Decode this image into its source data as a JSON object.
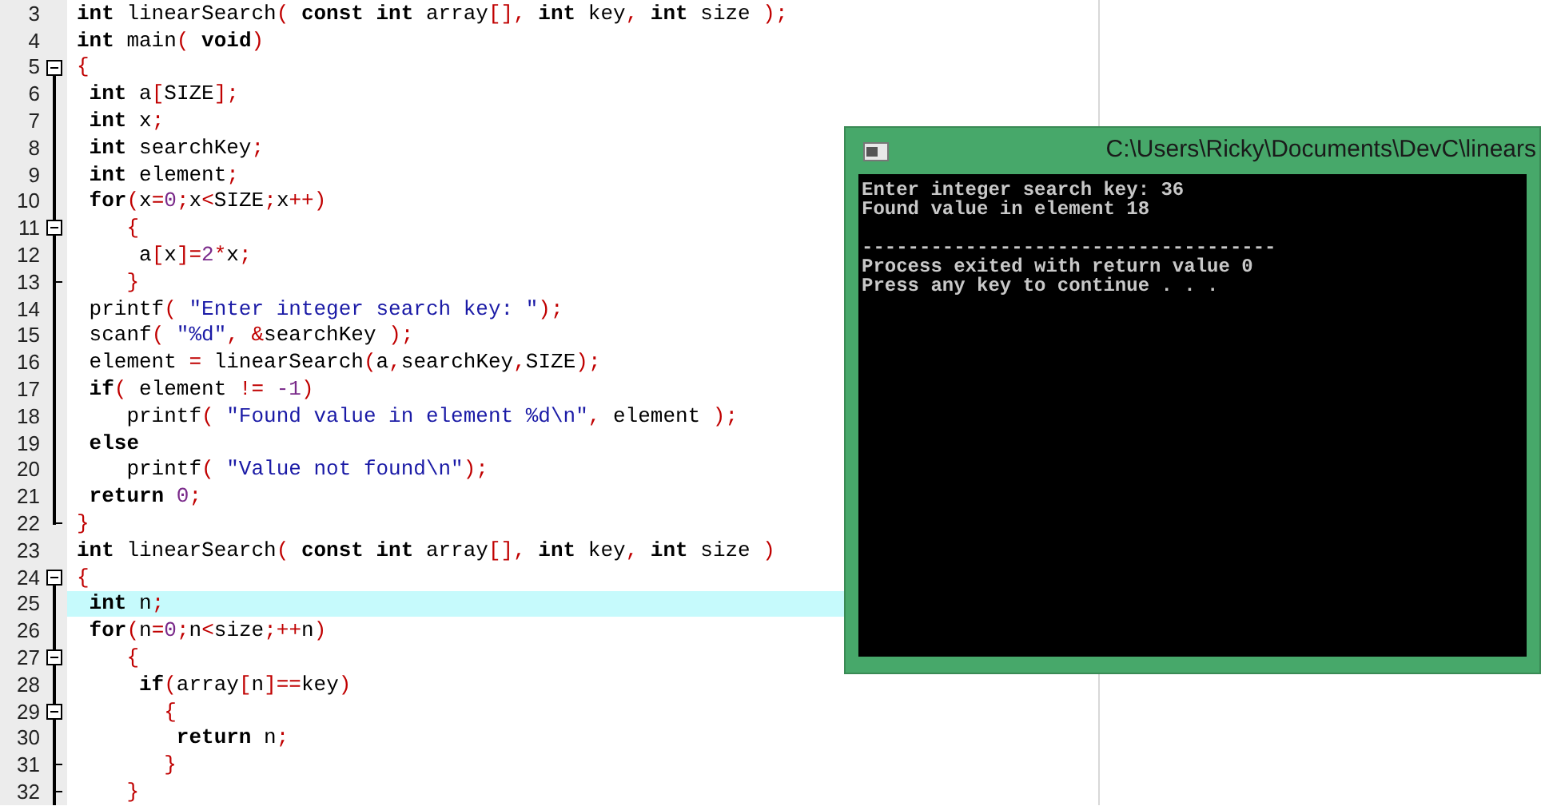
{
  "editor": {
    "lines": [
      {
        "number": "3",
        "kind": "none",
        "selected": false,
        "tokens": [
          {
            "kind": "kw",
            "text": "int"
          },
          {
            "kind": "id",
            "text": " linearSearch"
          },
          {
            "kind": "sym",
            "text": "("
          },
          {
            "kind": "kw",
            "text": " const int"
          },
          {
            "kind": "id",
            "text": " array"
          },
          {
            "kind": "sym",
            "text": "[],"
          },
          {
            "kind": "kw",
            "text": " int"
          },
          {
            "kind": "id",
            "text": " key"
          },
          {
            "kind": "sym",
            "text": ","
          },
          {
            "kind": "kw",
            "text": " int"
          },
          {
            "kind": "id",
            "text": " size "
          },
          {
            "kind": "sym",
            "text": ");"
          }
        ]
      },
      {
        "number": "4",
        "kind": "none",
        "selected": false,
        "tokens": [
          {
            "kind": "kw",
            "text": "int"
          },
          {
            "kind": "id",
            "text": " main"
          },
          {
            "kind": "sym",
            "text": "("
          },
          {
            "kind": "kw",
            "text": " void"
          },
          {
            "kind": "sym",
            "text": ")"
          }
        ]
      },
      {
        "number": "5",
        "kind": "open",
        "selected": false,
        "tokens": [
          {
            "kind": "sym",
            "text": "{"
          }
        ]
      },
      {
        "number": "6",
        "kind": "line",
        "selected": false,
        "tokens": [
          {
            "kind": "kw",
            "text": " int"
          },
          {
            "kind": "id",
            "text": " a"
          },
          {
            "kind": "sym",
            "text": "["
          },
          {
            "kind": "id",
            "text": "SIZE"
          },
          {
            "kind": "sym",
            "text": "];"
          }
        ]
      },
      {
        "number": "7",
        "kind": "line",
        "selected": false,
        "tokens": [
          {
            "kind": "kw",
            "text": " int"
          },
          {
            "kind": "id",
            "text": " x"
          },
          {
            "kind": "sym",
            "text": ";"
          }
        ]
      },
      {
        "number": "8",
        "kind": "line",
        "selected": false,
        "tokens": [
          {
            "kind": "kw",
            "text": " int"
          },
          {
            "kind": "id",
            "text": " searchKey"
          },
          {
            "kind": "sym",
            "text": ";"
          }
        ]
      },
      {
        "number": "9",
        "kind": "line",
        "selected": false,
        "tokens": [
          {
            "kind": "kw",
            "text": " int"
          },
          {
            "kind": "id",
            "text": " element"
          },
          {
            "kind": "sym",
            "text": ";"
          }
        ]
      },
      {
        "number": "10",
        "kind": "line",
        "selected": false,
        "tokens": [
          {
            "kind": "kw",
            "text": " for"
          },
          {
            "kind": "sym",
            "text": "("
          },
          {
            "kind": "id",
            "text": "x"
          },
          {
            "kind": "sym",
            "text": "="
          },
          {
            "kind": "num",
            "text": "0"
          },
          {
            "kind": "sym",
            "text": ";"
          },
          {
            "kind": "id",
            "text": "x"
          },
          {
            "kind": "sym",
            "text": "<"
          },
          {
            "kind": "id",
            "text": "SIZE"
          },
          {
            "kind": "sym",
            "text": ";"
          },
          {
            "kind": "id",
            "text": "x"
          },
          {
            "kind": "sym",
            "text": "++)"
          }
        ]
      },
      {
        "number": "11",
        "kind": "open_inner",
        "selected": false,
        "tokens": [
          {
            "kind": "sym",
            "text": "    {"
          }
        ]
      },
      {
        "number": "12",
        "kind": "line",
        "selected": false,
        "tokens": [
          {
            "kind": "id",
            "text": "     a"
          },
          {
            "kind": "sym",
            "text": "["
          },
          {
            "kind": "id",
            "text": "x"
          },
          {
            "kind": "sym",
            "text": "]="
          },
          {
            "kind": "num",
            "text": "2"
          },
          {
            "kind": "sym",
            "text": "*"
          },
          {
            "kind": "id",
            "text": "x"
          },
          {
            "kind": "sym",
            "text": ";"
          }
        ]
      },
      {
        "number": "13",
        "kind": "end_inner",
        "selected": false,
        "tokens": [
          {
            "kind": "sym",
            "text": "    }"
          }
        ]
      },
      {
        "number": "14",
        "kind": "line",
        "selected": false,
        "tokens": [
          {
            "kind": "id",
            "text": " printf"
          },
          {
            "kind": "sym",
            "text": "("
          },
          {
            "kind": "str",
            "text": " \"Enter integer search key: \""
          },
          {
            "kind": "sym",
            "text": ");"
          }
        ]
      },
      {
        "number": "15",
        "kind": "line",
        "selected": false,
        "tokens": [
          {
            "kind": "id",
            "text": " scanf"
          },
          {
            "kind": "sym",
            "text": "("
          },
          {
            "kind": "str",
            "text": " \"%d\""
          },
          {
            "kind": "sym",
            "text": ", &"
          },
          {
            "kind": "id",
            "text": "searchKey "
          },
          {
            "kind": "sym",
            "text": ");"
          }
        ]
      },
      {
        "number": "16",
        "kind": "line",
        "selected": false,
        "tokens": [
          {
            "kind": "id",
            "text": " element "
          },
          {
            "kind": "sym",
            "text": "="
          },
          {
            "kind": "id",
            "text": " linearSearch"
          },
          {
            "kind": "sym",
            "text": "("
          },
          {
            "kind": "id",
            "text": "a"
          },
          {
            "kind": "sym",
            "text": ","
          },
          {
            "kind": "id",
            "text": "searchKey"
          },
          {
            "kind": "sym",
            "text": ","
          },
          {
            "kind": "id",
            "text": "SIZE"
          },
          {
            "kind": "sym",
            "text": ");"
          }
        ]
      },
      {
        "number": "17",
        "kind": "line",
        "selected": false,
        "tokens": [
          {
            "kind": "kw",
            "text": " if"
          },
          {
            "kind": "sym",
            "text": "("
          },
          {
            "kind": "id",
            "text": " element "
          },
          {
            "kind": "sym",
            "text": "!= "
          },
          {
            "kind": "num",
            "text": "-1"
          },
          {
            "kind": "sym",
            "text": ")"
          }
        ]
      },
      {
        "number": "18",
        "kind": "line",
        "selected": false,
        "tokens": [
          {
            "kind": "id",
            "text": "    printf"
          },
          {
            "kind": "sym",
            "text": "("
          },
          {
            "kind": "str",
            "text": " \"Found value in element %d\\n\""
          },
          {
            "kind": "sym",
            "text": ","
          },
          {
            "kind": "id",
            "text": " element "
          },
          {
            "kind": "sym",
            "text": ");"
          }
        ]
      },
      {
        "number": "19",
        "kind": "line",
        "selected": false,
        "tokens": [
          {
            "kind": "kw",
            "text": " else"
          }
        ]
      },
      {
        "number": "20",
        "kind": "line",
        "selected": false,
        "tokens": [
          {
            "kind": "id",
            "text": "    printf"
          },
          {
            "kind": "sym",
            "text": "("
          },
          {
            "kind": "str",
            "text": " \"Value not found\\n\""
          },
          {
            "kind": "sym",
            "text": ");"
          }
        ]
      },
      {
        "number": "21",
        "kind": "line",
        "selected": false,
        "tokens": [
          {
            "kind": "kw",
            "text": " return"
          },
          {
            "kind": "num",
            "text": " 0"
          },
          {
            "kind": "sym",
            "text": ";"
          }
        ]
      },
      {
        "number": "22",
        "kind": "end",
        "selected": false,
        "tokens": [
          {
            "kind": "sym",
            "text": "}"
          }
        ]
      },
      {
        "number": "23",
        "kind": "none",
        "selected": false,
        "tokens": [
          {
            "kind": "kw",
            "text": "int"
          },
          {
            "kind": "id",
            "text": " linearSearch"
          },
          {
            "kind": "sym",
            "text": "("
          },
          {
            "kind": "kw",
            "text": " const int"
          },
          {
            "kind": "id",
            "text": " array"
          },
          {
            "kind": "sym",
            "text": "[],"
          },
          {
            "kind": "kw",
            "text": " int"
          },
          {
            "kind": "id",
            "text": " key"
          },
          {
            "kind": "sym",
            "text": ","
          },
          {
            "kind": "kw",
            "text": " int"
          },
          {
            "kind": "id",
            "text": " size "
          },
          {
            "kind": "sym",
            "text": ")"
          }
        ]
      },
      {
        "number": "24",
        "kind": "open",
        "selected": false,
        "tokens": [
          {
            "kind": "sym",
            "text": "{"
          }
        ]
      },
      {
        "number": "25",
        "kind": "line",
        "selected": true,
        "tokens": [
          {
            "kind": "kw",
            "text": " int"
          },
          {
            "kind": "id",
            "text": " n"
          },
          {
            "kind": "sym",
            "text": ";"
          }
        ]
      },
      {
        "number": "26",
        "kind": "line",
        "selected": false,
        "tokens": [
          {
            "kind": "kw",
            "text": " for"
          },
          {
            "kind": "sym",
            "text": "("
          },
          {
            "kind": "id",
            "text": "n"
          },
          {
            "kind": "sym",
            "text": "="
          },
          {
            "kind": "num",
            "text": "0"
          },
          {
            "kind": "sym",
            "text": ";"
          },
          {
            "kind": "id",
            "text": "n"
          },
          {
            "kind": "sym",
            "text": "<"
          },
          {
            "kind": "id",
            "text": "size"
          },
          {
            "kind": "sym",
            "text": ";++"
          },
          {
            "kind": "id",
            "text": "n"
          },
          {
            "kind": "sym",
            "text": ")"
          }
        ]
      },
      {
        "number": "27",
        "kind": "open_inner",
        "selected": false,
        "tokens": [
          {
            "kind": "sym",
            "text": "    {"
          }
        ]
      },
      {
        "number": "28",
        "kind": "line",
        "selected": false,
        "tokens": [
          {
            "kind": "kw",
            "text": "     if"
          },
          {
            "kind": "sym",
            "text": "("
          },
          {
            "kind": "id",
            "text": "array"
          },
          {
            "kind": "sym",
            "text": "["
          },
          {
            "kind": "id",
            "text": "n"
          },
          {
            "kind": "sym",
            "text": "]=="
          },
          {
            "kind": "id",
            "text": "key"
          },
          {
            "kind": "sym",
            "text": ")"
          }
        ]
      },
      {
        "number": "29",
        "kind": "open_inner",
        "selected": false,
        "tokens": [
          {
            "kind": "sym",
            "text": "       {"
          }
        ]
      },
      {
        "number": "30",
        "kind": "line",
        "selected": false,
        "tokens": [
          {
            "kind": "kw",
            "text": "        return"
          },
          {
            "kind": "id",
            "text": " n"
          },
          {
            "kind": "sym",
            "text": ";"
          }
        ]
      },
      {
        "number": "31",
        "kind": "end_inner",
        "selected": false,
        "tokens": [
          {
            "kind": "sym",
            "text": "       }"
          }
        ]
      },
      {
        "number": "32",
        "kind": "end_inner",
        "selected": false,
        "tokens": [
          {
            "kind": "sym",
            "text": "    }"
          }
        ]
      }
    ]
  },
  "console": {
    "title": "C:\\Users\\Ricky\\Documents\\DevC\\linears",
    "output": [
      "Enter integer search key: 36",
      "Found value in element 18"
    ],
    "footer": [
      "------------------------------------",
      "Process exited with return value 0",
      "Press any key to continue . . ."
    ]
  }
}
